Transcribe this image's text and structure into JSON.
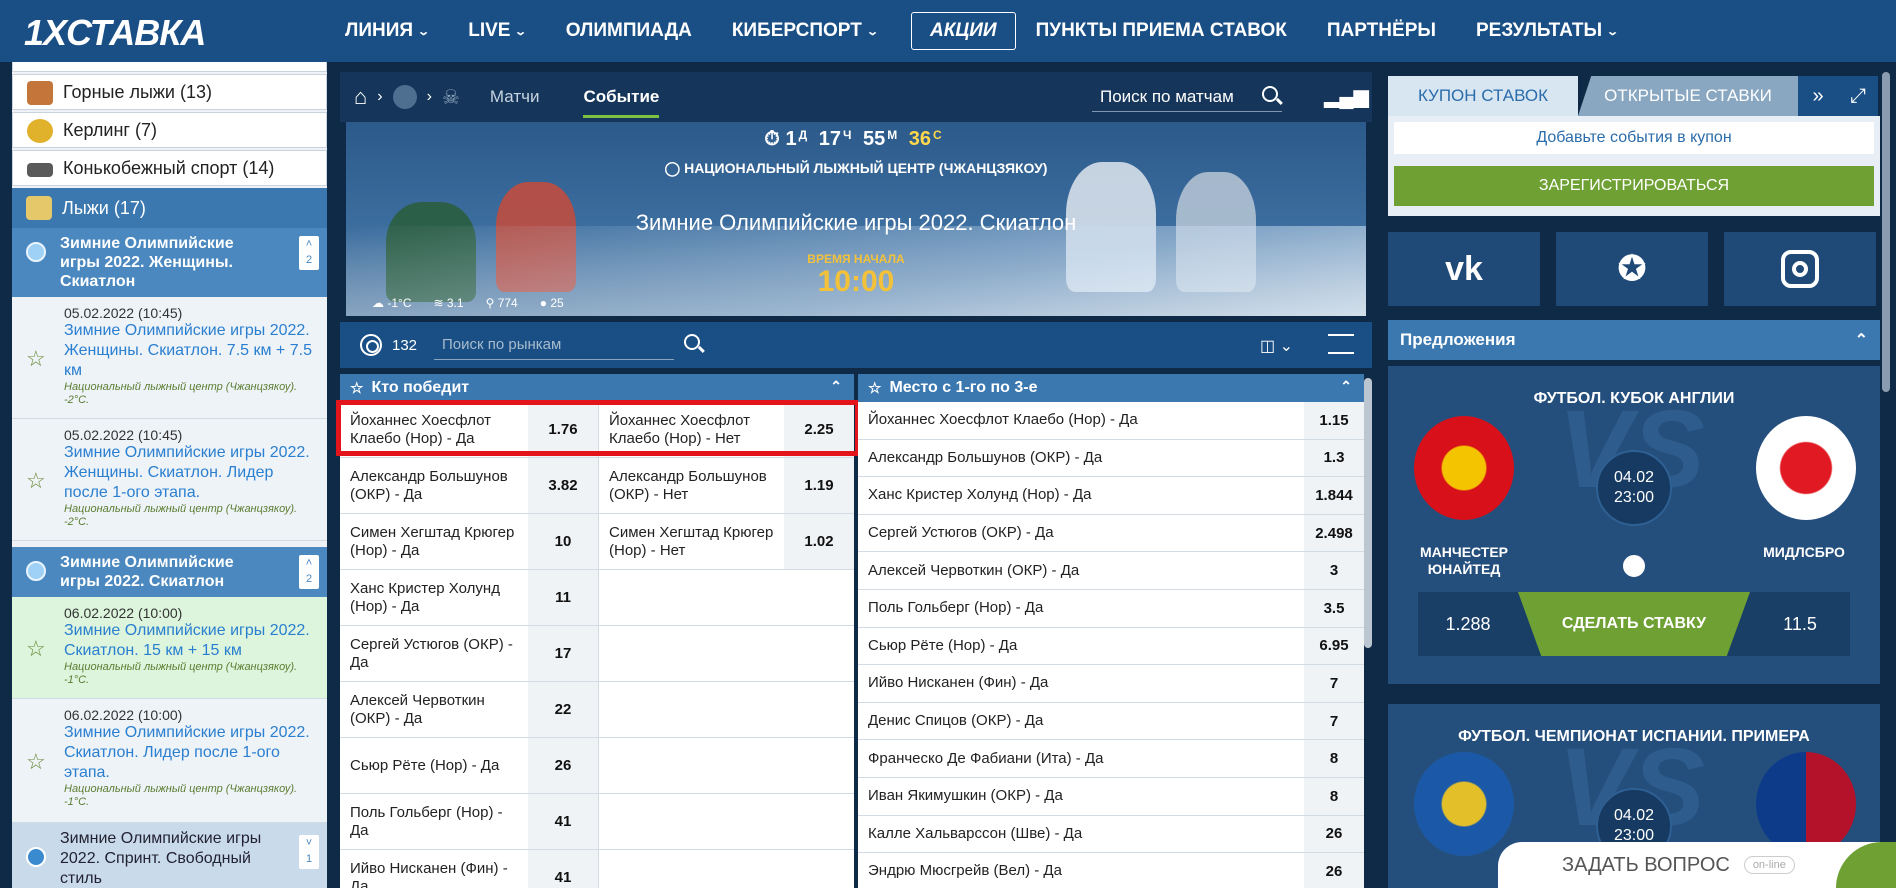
{
  "header": {
    "logo": "1XСТАВКА",
    "nav": [
      {
        "label": "ЛИНИЯ",
        "chevron": true
      },
      {
        "label": "LIVE",
        "chevron": true
      },
      {
        "label": "ОЛИМПИАДА",
        "chevron": false
      },
      {
        "label": "КИБЕРСПОРТ",
        "chevron": true
      },
      {
        "label": "АКЦИИ",
        "chevron": false
      },
      {
        "label": "ПУНКТЫ ПРИЕМА СТАВОК",
        "chevron": false
      },
      {
        "label": "ПАРТНЁРЫ",
        "chevron": false
      },
      {
        "label": "РЕЗУЛЬТАТЫ",
        "chevron": true
      }
    ]
  },
  "sidebar": {
    "sports": [
      {
        "label": "Горные лыжи (13)",
        "icon": "ski-icon"
      },
      {
        "label": "Керлинг (7)",
        "icon": "curling-icon"
      },
      {
        "label": "Конькобежный спорт (14)",
        "icon": "skate-icon"
      }
    ],
    "active_sport": "Лыжи (17)",
    "groups": [
      {
        "title": "Зимние Олимпийские игры 2022. Женщины. Скиатлон",
        "count": "2",
        "events": [
          {
            "date": "05.02.2022 (10:45)",
            "name": "Зимние Олимпийские игры 2022. Женщины. Скиатлон. 7.5 км + 7.5 км",
            "loc": "Национальный лыжный центр (Чжанцзякоу). -2°C."
          },
          {
            "date": "05.02.2022 (10:45)",
            "name": "Зимние Олимпийские игры 2022. Женщины. Скиатлон. Лидер после 1-ого этапа.",
            "loc": "Национальный лыжный центр (Чжанцзякоу). -2°C."
          }
        ]
      },
      {
        "title": "Зимние Олимпийские игры 2022. Скиатлон",
        "count": "2",
        "events": [
          {
            "date": "06.02.2022 (10:00)",
            "name": "Зимние Олимпийские игры 2022. Скиатлон. 15 км + 15 км",
            "loc": "Национальный лыжный центр (Чжанцзякоу). -1°C."
          },
          {
            "date": "06.02.2022 (10:00)",
            "name": "Зимние Олимпийские игры 2022. Скиатлон. Лидер после 1-ого этапа.",
            "loc": "Национальный лыжный центр (Чжанцзякоу). -1°C."
          }
        ]
      }
    ],
    "last_group": {
      "title": "Зимние Олимпийские игры 2022. Спринт. Свободный стиль",
      "count": "1"
    }
  },
  "crumbs": {
    "matches": "Матчи",
    "event": "Событие",
    "search": "Поиск по матчам"
  },
  "banner": {
    "timer": {
      "d": "1",
      "du": "Д",
      "h": "17",
      "hu": "Ч",
      "m": "55",
      "mu": "М",
      "s": "36",
      "su": "С"
    },
    "venue": "НАЦИОНАЛЬНЫЙ ЛЫЖНЫЙ ЦЕНТР (ЧЖАНЦЗЯКОУ)",
    "title": "Зимние Олимпийские игры 2022. Скиатлон",
    "start_label": "ВРЕМЯ НАЧАЛА",
    "start_time": "10:00",
    "weather": {
      "temp": "-1°C",
      "wind": "3.1",
      "pressure": "774",
      "humidity": "25"
    }
  },
  "markets_bar": {
    "count": "132",
    "search": "Поиск по рынкам"
  },
  "market_winner": {
    "title": "Кто победит",
    "rows": [
      {
        "yes": "Йоханнес Хоесфлот Клаебо (Нор) - Да",
        "yes_odd": "1.76",
        "no": "Йоханнес Хоесфлот Клаебо (Нор) - Нет",
        "no_odd": "2.25"
      },
      {
        "yes": "Александр Большунов (ОКР) - Да",
        "yes_odd": "3.82",
        "no": "Александр Большунов (ОКР) - Нет",
        "no_odd": "1.19"
      },
      {
        "yes": "Симен Хегштад Крюгер (Нор) - Да",
        "yes_odd": "10",
        "no": "Симен Хегштад Крюгер (Нор) - Нет",
        "no_odd": "1.02"
      },
      {
        "yes": "Ханс Кристер Холунд (Нор) - Да",
        "yes_odd": "11",
        "no": "",
        "no_odd": ""
      },
      {
        "yes": "Сергей Устюгов (ОКР) - Да",
        "yes_odd": "17",
        "no": "",
        "no_odd": ""
      },
      {
        "yes": "Алексей Червоткин (ОКР) - Да",
        "yes_odd": "22",
        "no": "",
        "no_odd": ""
      },
      {
        "yes": "Сьюр Рёте (Нор) - Да",
        "yes_odd": "26",
        "no": "",
        "no_odd": ""
      },
      {
        "yes": "Поль Гольберг (Нор) - Да",
        "yes_odd": "41",
        "no": "",
        "no_odd": ""
      },
      {
        "yes": "Ийво Нисканен (Фин) - Да",
        "yes_odd": "41",
        "no": "",
        "no_odd": ""
      }
    ]
  },
  "market_podium": {
    "title": "Место с 1-го по 3-е",
    "rows": [
      {
        "name": "Йоханнес Хоесфлот Клаебо (Нор) - Да",
        "odd": "1.15"
      },
      {
        "name": "Александр Большунов (ОКР) - Да",
        "odd": "1.3"
      },
      {
        "name": "Ханс Кристер Холунд (Нор) - Да",
        "odd": "1.844"
      },
      {
        "name": "Сергей Устюгов (ОКР) - Да",
        "odd": "2.498"
      },
      {
        "name": "Алексей Червоткин (ОКР) - Да",
        "odd": "3"
      },
      {
        "name": "Поль Гольберг (Нор) - Да",
        "odd": "3.5"
      },
      {
        "name": "Сьюр Рёте (Нор) - Да",
        "odd": "6.95"
      },
      {
        "name": "Ийво Нисканен (Фин) - Да",
        "odd": "7"
      },
      {
        "name": "Денис Спицов (ОКР) - Да",
        "odd": "7"
      },
      {
        "name": "Франческо Де Фабиани (Ита) - Да",
        "odd": "8"
      },
      {
        "name": "Иван Якимушкин (ОКР) - Да",
        "odd": "8"
      },
      {
        "name": "Калле Хальварссон (Шве) - Да",
        "odd": "26"
      },
      {
        "name": "Эндрю Мюсгрейв (Вел) - Да",
        "odd": "26"
      }
    ]
  },
  "coupon": {
    "tab_coupon": "КУПОН СТАВОК",
    "tab_open": "ОТКРЫТЫЕ СТАВКИ",
    "add_events": "Добавьте события в купон",
    "register": "ЗАРЕГИСТРИРОВАТЬСЯ"
  },
  "social": [
    "vk-icon",
    "twitter-icon",
    "instagram-icon"
  ],
  "offers": {
    "title": "Предложения",
    "items": [
      {
        "league": "ФУТБОЛ. КУБОК АНГЛИИ",
        "date": "04.02",
        "time": "23:00",
        "team1": "МАНЧЕСТЕР ЮНАЙТЕД",
        "team2": "МИДЛСБРО",
        "odd1": "1.288",
        "bet": "СДЕЛАТЬ СТАВКУ",
        "odd2": "11.5"
      },
      {
        "league": "ФУТБОЛ. ЧЕМПИОНАТ ИСПАНИИ. ПРИМЕРА",
        "date": "04.02",
        "time": "23:00"
      }
    ]
  },
  "ask": {
    "label": "ЗАДАТЬ ВОПРОС",
    "status": "on-line"
  },
  "colors": {
    "brand": "#1a4f85",
    "accent_green": "#6ea033",
    "highlight_red": "#e4141b"
  }
}
